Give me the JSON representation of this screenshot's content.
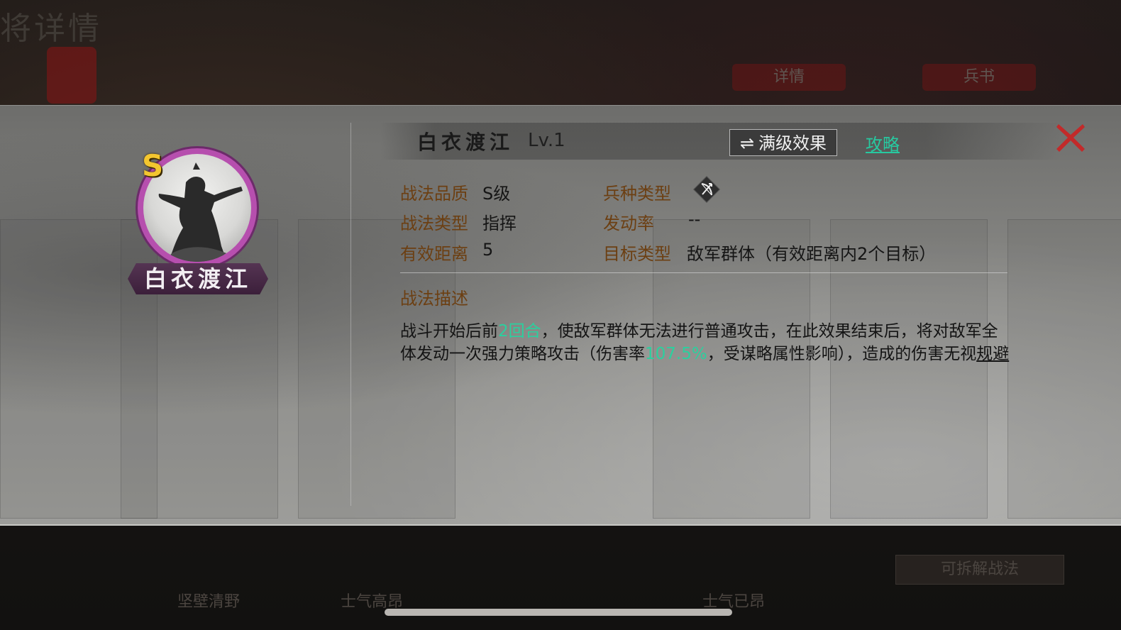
{
  "background": {
    "title": "将详情",
    "tabs": [
      "详情",
      "兵书"
    ],
    "bottom_items": [
      "坚壁清野",
      "士气高昂",
      "士气已昂"
    ],
    "bottom_button": "可拆解战法"
  },
  "skill": {
    "grade_badge": "S",
    "name": "白衣渡江",
    "level": "Lv.1",
    "max_level_button": "满级效果",
    "guide_link": "攻略",
    "info": {
      "quality_label": "战法品质",
      "quality_value": "S级",
      "type_label": "战法类型",
      "type_value": "指挥",
      "range_label": "有效距离",
      "range_value": "5",
      "troop_label": "兵种类型",
      "rate_label": "发动率",
      "rate_value": "--",
      "target_label": "目标类型",
      "target_value": "敌军群体（有效距离内2个目标）"
    },
    "description_title": "战法描述",
    "description": {
      "part1": "战斗开始后前",
      "hl1": "2回合",
      "part2": "，使敌军群体无法进行普通攻击，在此效果结束后，将对敌军全体发动一次强力策略攻击（伤害率",
      "hl2": "107.5%",
      "part3": "，受谋略属性影响），造成的伤害无视",
      "keyword": "规避"
    }
  },
  "colors": {
    "label": "#6c3f12",
    "highlight": "#2bd09e",
    "link": "#27c9a0",
    "close": "#c22a2a",
    "grade": "#f4c62f",
    "icon_ring": "#b64fae"
  },
  "icons": {
    "close": "close-x-icon",
    "swap": "swap-arrows-icon",
    "troop": "bow-troop-icon"
  }
}
